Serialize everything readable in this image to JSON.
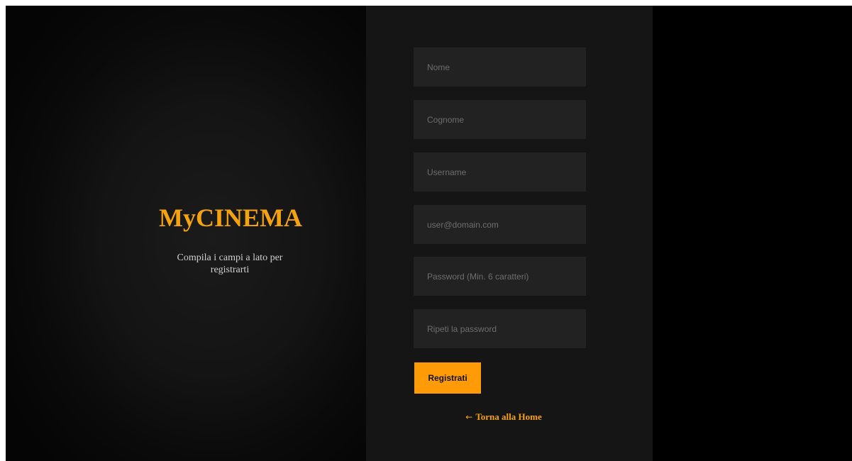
{
  "brand": {
    "title": "MyCINEMA",
    "subtitle": "Compila i campi a lato per registrarti"
  },
  "form": {
    "fields": [
      {
        "placeholder": "Nome",
        "value": ""
      },
      {
        "placeholder": "Cognome",
        "value": ""
      },
      {
        "placeholder": "Username",
        "value": ""
      },
      {
        "placeholder": "user@domain.com",
        "value": ""
      },
      {
        "placeholder": "Password (Min. 6 caratteri)",
        "value": ""
      },
      {
        "placeholder": "Ripeti la password",
        "value": ""
      }
    ],
    "submit_label": "Registrati"
  },
  "nav": {
    "home_arrow": "←",
    "home_link": "Torna alla Home"
  },
  "colors": {
    "accent": "#fe9b06",
    "background": "#000000",
    "form_panel": "#151515",
    "field_bg": "#222222"
  }
}
